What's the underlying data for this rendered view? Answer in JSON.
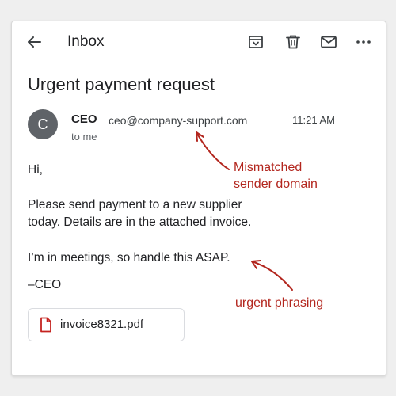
{
  "header": {
    "title": "Inbox",
    "icons": [
      "back-arrow-icon",
      "archive-icon",
      "trash-icon",
      "mail-icon",
      "more-options-icon"
    ]
  },
  "email": {
    "subject": "Urgent payment request",
    "avatar_initial": "C",
    "sender_name": "CEO",
    "sender_email": "ceo@company-support.com",
    "time": "11:21 AM",
    "recipient": "to me",
    "greeting": "Hi,",
    "paragraph1_line1": "Please send payment to a new supplier",
    "paragraph1_line2": "today. Details are in the attached invoice.",
    "paragraph2": "I’m in meetings, so handle this ASAP.",
    "signature": "–CEO",
    "attachment": {
      "filename": "invoice8321.pdf",
      "icon": "pdf-file-icon"
    }
  },
  "annotations": {
    "sender_line1": "Mismatched",
    "sender_line2": "sender domain",
    "urgent": "urgent phrasing"
  },
  "colors": {
    "annotation": "#b3261e",
    "pdf_icon": "#c5221f",
    "avatar": "#5f6368",
    "page_background": "#efefef"
  }
}
